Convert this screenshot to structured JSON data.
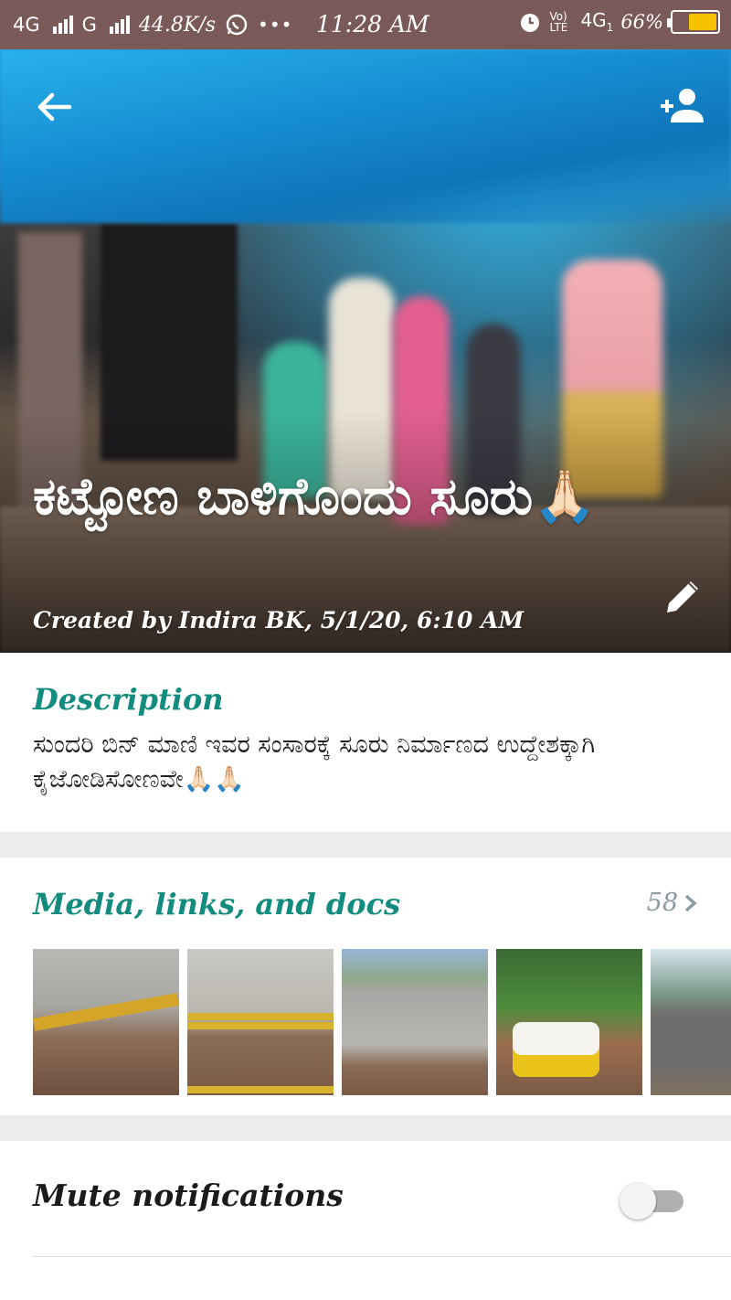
{
  "status_bar": {
    "network_1": "4G",
    "network_2": "G",
    "speed": "44.8K/s",
    "overflow": "•••",
    "time": "11:28 AM",
    "volte": "Vo) LTE",
    "network_right": "4G",
    "sim": "1",
    "battery_percent": "66%",
    "battery_level": 0.66,
    "battery_color": "#f5c100"
  },
  "header": {
    "title": "ಕಟ್ಟೋಣ ಬಾಳಿಗೊಂದು ಸೂರು🙏🏻",
    "created_by": "Created by Indira BK, 5/1/20, 6:10 AM",
    "icons": {
      "back": "arrow-back-icon",
      "add_participant": "add-person-icon",
      "edit": "pencil-icon"
    }
  },
  "description": {
    "title": "Description",
    "text": "ಸುಂದರಿ ಬಿನ್ ಮಾಣಿ ಇವರ ಸಂಸಾರಕ್ಕೆ ಸೂರು ನಿರ್ಮಾಣದ ಉದ್ದೇಶಕ್ಕಾಗಿ ಕೈಜೋಡಿಸೋಣವೇ🙏🏻🙏🏻"
  },
  "media": {
    "title": "Media, links, and docs",
    "count": "58",
    "thumbnails": [
      "media-thumb-1",
      "media-thumb-2",
      "media-thumb-3",
      "media-thumb-4",
      "media-thumb-5"
    ]
  },
  "mute": {
    "label": "Mute notifications",
    "enabled": false
  },
  "colors": {
    "accent": "#128c7e",
    "status_bar": "#7a5a58"
  }
}
